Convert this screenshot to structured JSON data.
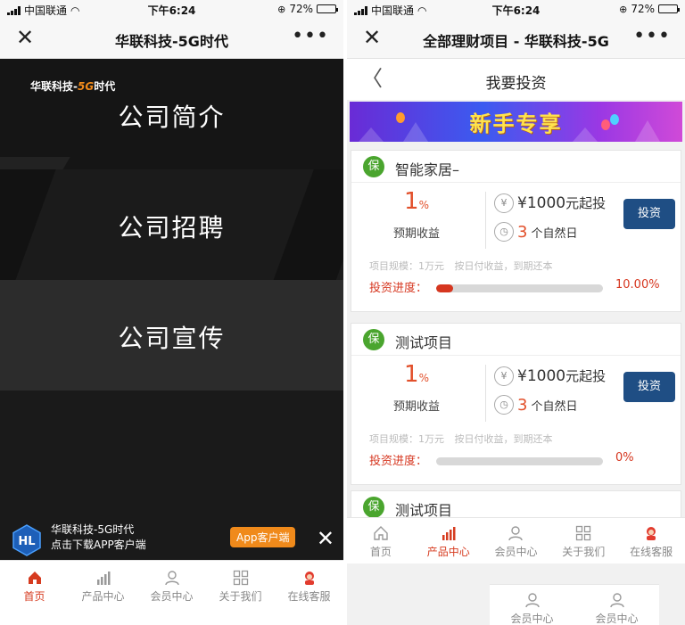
{
  "status": {
    "carrier": "中国联通",
    "time": "下午6:24",
    "battery": "72%",
    "battery_level": 0.72
  },
  "left": {
    "navbar": {
      "title": "华联科技-5G时代"
    },
    "logo": {
      "prefix": "华联科技-",
      "accent": "5G",
      "suffix": "时代"
    },
    "menu": [
      "公司简介",
      "公司招聘",
      "公司宣传"
    ],
    "download": {
      "line1": "华联科技-5G时代",
      "line2": "点击下载APP客户端",
      "button": "App客户端"
    },
    "tabs": [
      {
        "label": "首页",
        "icon": "home-icon",
        "active": true
      },
      {
        "label": "产品中心",
        "icon": "bar-chart-icon",
        "active": false
      },
      {
        "label": "会员中心",
        "icon": "user-icon",
        "active": false
      },
      {
        "label": "关于我们",
        "icon": "grid-icon",
        "active": false
      },
      {
        "label": "在线客服",
        "icon": "support-agent-icon",
        "active": false
      }
    ]
  },
  "right": {
    "navbar": {
      "title": "全部理财项目 - 华联科技-5G"
    },
    "subnav": {
      "title": "我要投资"
    },
    "banner": {
      "text": "新手专享"
    },
    "badge": "保",
    "products": [
      {
        "name": "智能家居–",
        "rate": "1",
        "rate_unit": "%",
        "rate_label": "预期收益",
        "currency": "¥",
        "min_amount": "¥1000",
        "min_suffix": "元起投",
        "days": "3",
        "days_suffix": "个自然日",
        "button": "投资",
        "meta": "项目规模：1万元 按日付收益，到期还本",
        "progress_label": "投资进度：",
        "progress": 0.1,
        "progress_text": "10.00%"
      },
      {
        "name": "测试项目",
        "rate": "1",
        "rate_unit": "%",
        "rate_label": "预期收益",
        "currency": "¥",
        "min_amount": "¥1000",
        "min_suffix": "元起投",
        "days": "3",
        "days_suffix": "个自然日",
        "button": "投资",
        "meta": "项目规模：1万元 按日付收益，到期还本",
        "progress_label": "投资进度：",
        "progress": 0.0,
        "progress_text": "0%"
      },
      {
        "name": "测试项目"
      }
    ],
    "tabs": [
      {
        "label": "首页",
        "icon": "home-icon",
        "active": false
      },
      {
        "label": "产品中心",
        "icon": "bar-chart-icon",
        "active": true
      },
      {
        "label": "会员中心",
        "icon": "user-icon",
        "active": false
      },
      {
        "label": "关于我们",
        "icon": "grid-icon",
        "active": false
      },
      {
        "label": "在线客服",
        "icon": "support-agent-icon",
        "active": false
      }
    ],
    "popup_items": [
      "会员中心",
      "会员中心"
    ]
  },
  "colors": {
    "accent_red": "#d63b1f",
    "invest_blue": "#1f4e84",
    "badge_green": "#4aa52e",
    "logo_orange": "#f08a1b"
  }
}
